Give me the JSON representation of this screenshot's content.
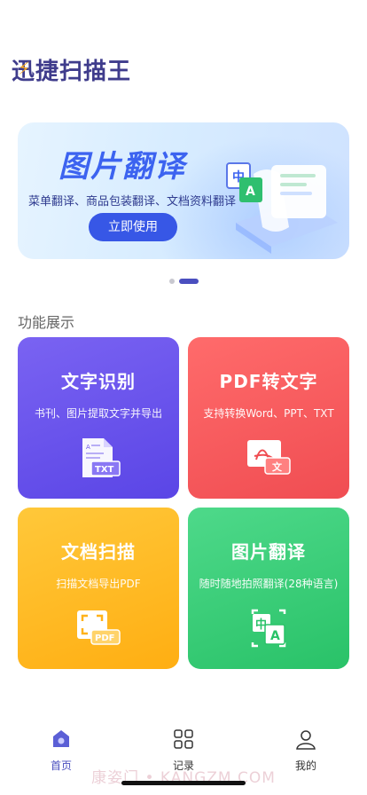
{
  "header": {
    "app_title": "迅捷扫描王"
  },
  "banner": {
    "title": "图片翻译",
    "subtitle": "菜单翻译、商品包装翻译、文档资料翻译",
    "button_label": "立即使用",
    "illus_zh": "中",
    "illus_a": "A"
  },
  "pager": {
    "count": 2,
    "active_index": 1
  },
  "section": {
    "title": "功能展示"
  },
  "features": [
    {
      "title": "文字识别",
      "desc": "书刊、图片提取文字并导出",
      "icon_text": "TXT"
    },
    {
      "title": "PDF转文字",
      "desc": "支持转换Word、PPT、TXT",
      "icon_text": "文"
    },
    {
      "title": "文档扫描",
      "desc": "扫描文档导出PDF",
      "icon_text": "PDF"
    },
    {
      "title": "图片翻译",
      "desc": "随时随地拍照翻译(28种语言)",
      "icon_text_zh": "中",
      "icon_text_a": "A"
    }
  ],
  "bottom_nav": [
    {
      "label": "首页",
      "active": true
    },
    {
      "label": "记录",
      "active": false
    },
    {
      "label": "我的",
      "active": false
    }
  ],
  "watermark": "康姿门 • KANGZM.COM",
  "colors": {
    "accent": "#4a4fbf",
    "banner_button": "#3757e6"
  }
}
